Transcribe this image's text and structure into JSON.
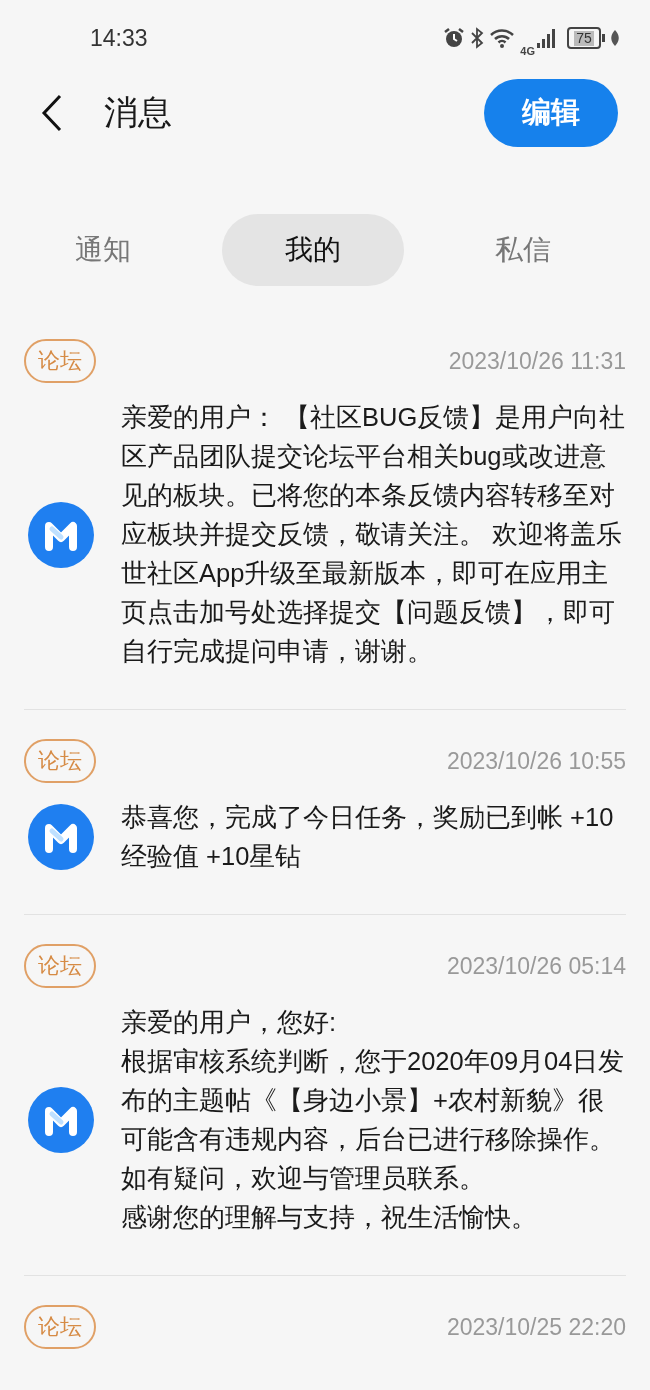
{
  "status_bar": {
    "time": "14:33",
    "network": "4G",
    "battery": "75"
  },
  "header": {
    "title": "消息",
    "edit_button": "编辑"
  },
  "tabs": [
    {
      "label": "通知",
      "selected": false
    },
    {
      "label": "我的",
      "selected": true
    },
    {
      "label": "私信",
      "selected": false
    }
  ],
  "messages": [
    {
      "tag": "论坛",
      "time": "2023/10/26 11:31",
      "body": [
        "亲爱的用户： 【社区BUG反馈】是用户向社区产品团队提交论坛平台相关bug或改进意见的板块。已将您的本条反馈内容转移至对应板块并提交反馈，敬请关注。 欢迎将盖乐世社区App升级至最新版本，即可在应用主页点击加号处选择提交【问题反馈】，即可自行完成提问申请，谢谢。"
      ]
    },
    {
      "tag": "论坛",
      "time": "2023/10/26 10:55",
      "body": [
        "恭喜您，完成了今日任务，奖励已到帐 +10经验值 +10星钻"
      ]
    },
    {
      "tag": "论坛",
      "time": "2023/10/26 05:14",
      "body": [
        "亲爱的用户，您好:",
        "根据审核系统判断，您于2020年09月04日发布的主题帖《【身边小景】+农村新貌》很可能含有违规内容，后台已进行移除操作。如有疑问，欢迎与管理员联系。",
        "感谢您的理解与支持，祝生活愉快。"
      ]
    },
    {
      "tag": "论坛",
      "time": "2023/10/25 22:20"
    }
  ]
}
